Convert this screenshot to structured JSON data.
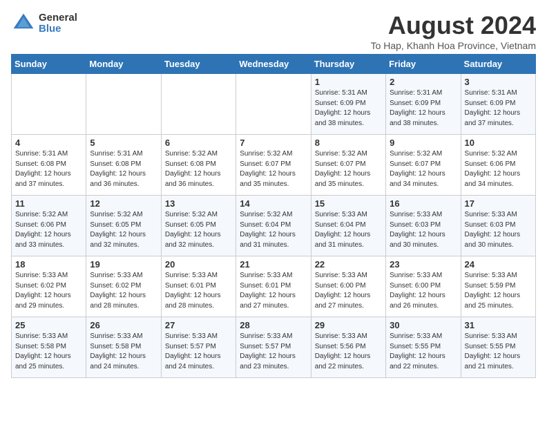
{
  "logo": {
    "general": "General",
    "blue": "Blue"
  },
  "title": "August 2024",
  "subtitle": "To Hap, Khanh Hoa Province, Vietnam",
  "headers": [
    "Sunday",
    "Monday",
    "Tuesday",
    "Wednesday",
    "Thursday",
    "Friday",
    "Saturday"
  ],
  "weeks": [
    [
      {
        "day": "",
        "info": ""
      },
      {
        "day": "",
        "info": ""
      },
      {
        "day": "",
        "info": ""
      },
      {
        "day": "",
        "info": ""
      },
      {
        "day": "1",
        "info": "Sunrise: 5:31 AM\nSunset: 6:09 PM\nDaylight: 12 hours\nand 38 minutes."
      },
      {
        "day": "2",
        "info": "Sunrise: 5:31 AM\nSunset: 6:09 PM\nDaylight: 12 hours\nand 38 minutes."
      },
      {
        "day": "3",
        "info": "Sunrise: 5:31 AM\nSunset: 6:09 PM\nDaylight: 12 hours\nand 37 minutes."
      }
    ],
    [
      {
        "day": "4",
        "info": "Sunrise: 5:31 AM\nSunset: 6:08 PM\nDaylight: 12 hours\nand 37 minutes."
      },
      {
        "day": "5",
        "info": "Sunrise: 5:31 AM\nSunset: 6:08 PM\nDaylight: 12 hours\nand 36 minutes."
      },
      {
        "day": "6",
        "info": "Sunrise: 5:32 AM\nSunset: 6:08 PM\nDaylight: 12 hours\nand 36 minutes."
      },
      {
        "day": "7",
        "info": "Sunrise: 5:32 AM\nSunset: 6:07 PM\nDaylight: 12 hours\nand 35 minutes."
      },
      {
        "day": "8",
        "info": "Sunrise: 5:32 AM\nSunset: 6:07 PM\nDaylight: 12 hours\nand 35 minutes."
      },
      {
        "day": "9",
        "info": "Sunrise: 5:32 AM\nSunset: 6:07 PM\nDaylight: 12 hours\nand 34 minutes."
      },
      {
        "day": "10",
        "info": "Sunrise: 5:32 AM\nSunset: 6:06 PM\nDaylight: 12 hours\nand 34 minutes."
      }
    ],
    [
      {
        "day": "11",
        "info": "Sunrise: 5:32 AM\nSunset: 6:06 PM\nDaylight: 12 hours\nand 33 minutes."
      },
      {
        "day": "12",
        "info": "Sunrise: 5:32 AM\nSunset: 6:05 PM\nDaylight: 12 hours\nand 32 minutes."
      },
      {
        "day": "13",
        "info": "Sunrise: 5:32 AM\nSunset: 6:05 PM\nDaylight: 12 hours\nand 32 minutes."
      },
      {
        "day": "14",
        "info": "Sunrise: 5:32 AM\nSunset: 6:04 PM\nDaylight: 12 hours\nand 31 minutes."
      },
      {
        "day": "15",
        "info": "Sunrise: 5:33 AM\nSunset: 6:04 PM\nDaylight: 12 hours\nand 31 minutes."
      },
      {
        "day": "16",
        "info": "Sunrise: 5:33 AM\nSunset: 6:03 PM\nDaylight: 12 hours\nand 30 minutes."
      },
      {
        "day": "17",
        "info": "Sunrise: 5:33 AM\nSunset: 6:03 PM\nDaylight: 12 hours\nand 30 minutes."
      }
    ],
    [
      {
        "day": "18",
        "info": "Sunrise: 5:33 AM\nSunset: 6:02 PM\nDaylight: 12 hours\nand 29 minutes."
      },
      {
        "day": "19",
        "info": "Sunrise: 5:33 AM\nSunset: 6:02 PM\nDaylight: 12 hours\nand 28 minutes."
      },
      {
        "day": "20",
        "info": "Sunrise: 5:33 AM\nSunset: 6:01 PM\nDaylight: 12 hours\nand 28 minutes."
      },
      {
        "day": "21",
        "info": "Sunrise: 5:33 AM\nSunset: 6:01 PM\nDaylight: 12 hours\nand 27 minutes."
      },
      {
        "day": "22",
        "info": "Sunrise: 5:33 AM\nSunset: 6:00 PM\nDaylight: 12 hours\nand 27 minutes."
      },
      {
        "day": "23",
        "info": "Sunrise: 5:33 AM\nSunset: 6:00 PM\nDaylight: 12 hours\nand 26 minutes."
      },
      {
        "day": "24",
        "info": "Sunrise: 5:33 AM\nSunset: 5:59 PM\nDaylight: 12 hours\nand 25 minutes."
      }
    ],
    [
      {
        "day": "25",
        "info": "Sunrise: 5:33 AM\nSunset: 5:58 PM\nDaylight: 12 hours\nand 25 minutes."
      },
      {
        "day": "26",
        "info": "Sunrise: 5:33 AM\nSunset: 5:58 PM\nDaylight: 12 hours\nand 24 minutes."
      },
      {
        "day": "27",
        "info": "Sunrise: 5:33 AM\nSunset: 5:57 PM\nDaylight: 12 hours\nand 24 minutes."
      },
      {
        "day": "28",
        "info": "Sunrise: 5:33 AM\nSunset: 5:57 PM\nDaylight: 12 hours\nand 23 minutes."
      },
      {
        "day": "29",
        "info": "Sunrise: 5:33 AM\nSunset: 5:56 PM\nDaylight: 12 hours\nand 22 minutes."
      },
      {
        "day": "30",
        "info": "Sunrise: 5:33 AM\nSunset: 5:55 PM\nDaylight: 12 hours\nand 22 minutes."
      },
      {
        "day": "31",
        "info": "Sunrise: 5:33 AM\nSunset: 5:55 PM\nDaylight: 12 hours\nand 21 minutes."
      }
    ]
  ]
}
